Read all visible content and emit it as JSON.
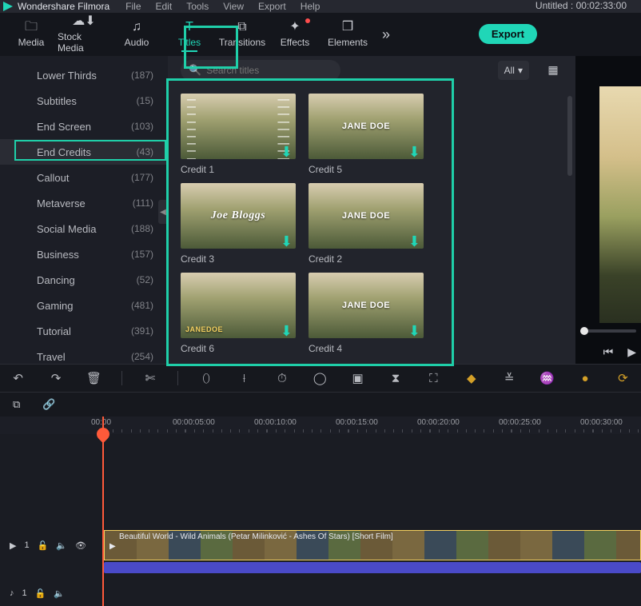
{
  "app_name": "Wondershare Filmora",
  "project_title": "Untitled : 00:02:33:00",
  "menus": [
    "File",
    "Edit",
    "Tools",
    "View",
    "Export",
    "Help"
  ],
  "tabs": [
    {
      "id": "media",
      "label": "Media"
    },
    {
      "id": "stock",
      "label": "Stock Media"
    },
    {
      "id": "audio",
      "label": "Audio"
    },
    {
      "id": "titles",
      "label": "Titles"
    },
    {
      "id": "transitions",
      "label": "Transitions"
    },
    {
      "id": "effects",
      "label": "Effects"
    },
    {
      "id": "elements",
      "label": "Elements"
    }
  ],
  "active_tab": "titles",
  "export_label": "Export",
  "categories": [
    {
      "name": "Lower Thirds",
      "count": 187
    },
    {
      "name": "Subtitles",
      "count": 15
    },
    {
      "name": "End Screen",
      "count": 103
    },
    {
      "name": "End Credits",
      "count": 43,
      "selected": true
    },
    {
      "name": "Callout",
      "count": 177
    },
    {
      "name": "Metaverse",
      "count": 111
    },
    {
      "name": "Social Media",
      "count": 188
    },
    {
      "name": "Business",
      "count": 157
    },
    {
      "name": "Dancing",
      "count": 52
    },
    {
      "name": "Gaming",
      "count": 481
    },
    {
      "name": "Tutorial",
      "count": 391
    },
    {
      "name": "Travel",
      "count": 254
    }
  ],
  "search": {
    "placeholder": "Search titles"
  },
  "filter": {
    "label": "All"
  },
  "thumbs": [
    {
      "label": "Credit 1",
      "overlay_kind": "credits"
    },
    {
      "label": "Credit 5",
      "overlay_kind": "name",
      "overlay": "JANE DOE"
    },
    {
      "label": "Credit 3",
      "overlay_kind": "name",
      "overlay": "Joe Bloggs",
      "cursive": true
    },
    {
      "label": "Credit 2",
      "overlay_kind": "name",
      "overlay": "JANE DOE"
    },
    {
      "label": "Credit 6",
      "overlay_kind": "corner",
      "overlay": "JANEDOE"
    },
    {
      "label": "Credit 4",
      "overlay_kind": "name",
      "overlay": "JANE DOE"
    }
  ],
  "ruler": [
    "00:00",
    "00:00:05:00",
    "00:00:10:00",
    "00:00:15:00",
    "00:00:20:00",
    "00:00:25:00",
    "00:00:30:00"
  ],
  "clip": {
    "label": "Beautiful World - Wild Animals (Petar Milinković - Ashes Of Stars) [Short Film]"
  },
  "track_video": {
    "label": "1"
  },
  "track_audio": {
    "label": "1"
  }
}
